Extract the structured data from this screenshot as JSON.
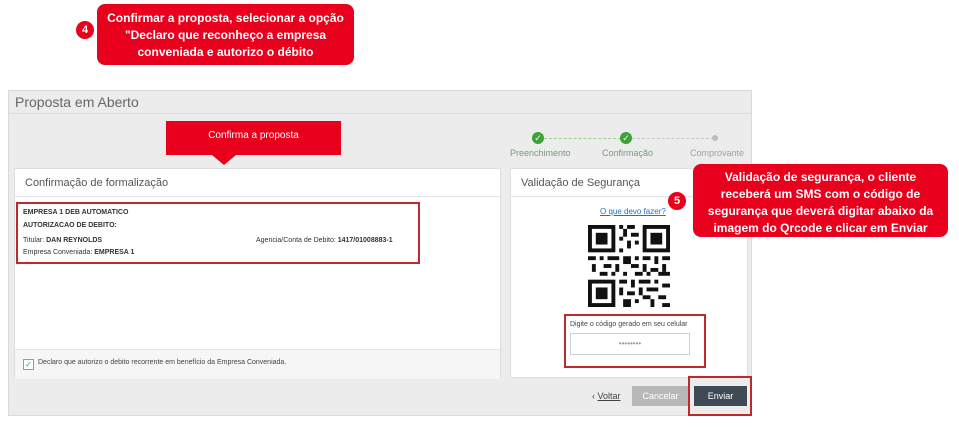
{
  "callouts": {
    "step4_number": "4",
    "step4_text": "Confirmar a proposta, selecionar a opção \"Declaro que reconheço a empresa conveniada e autorizo o débito",
    "step5_number": "5",
    "step5_text": "Validação de segurança, o cliente receberá um SMS com o código de segurança que deverá digitar abaixo da imagem do Qrcode e clicar em Enviar",
    "confirma_label": "Confirma a proposta"
  },
  "panel": {
    "title": "Proposta em Aberto"
  },
  "stepper": {
    "steps": [
      {
        "label": "Preenchimento",
        "state": "done"
      },
      {
        "label": "Confirmação",
        "state": "done"
      },
      {
        "label": "Comprovante",
        "state": "pending"
      }
    ],
    "check_glyph": "✓"
  },
  "formalizacao": {
    "header": "Confirmação de formalização",
    "line1": "EMPRESA 1 DEB AUTOMATICO",
    "line2": "AUTORIZACAO DE DEBITO:",
    "titular_label": "Titular:",
    "titular_value": "DAN REYNOLDS",
    "conta_label": "Agencia/Conta de Debito:",
    "conta_value": "1417/01008883-1",
    "empresa_label": "Empresa Conveniada:",
    "empresa_value": "EMPRESA 1",
    "checkbox_label": "Declaro que autorizo o debito recorrente em benefício da Empresa Conveniada."
  },
  "seguranca": {
    "header": "Validação de Segurança",
    "help_link": "O que devo fazer?",
    "code_label": "Digite o código gerado em seu celular",
    "code_placeholder": "••••••••"
  },
  "actions": {
    "voltar": "Voltar",
    "voltar_prefix": "‹",
    "cancelar": "Cancelar",
    "enviar": "Enviar"
  },
  "colors": {
    "accent_red": "#e8001c",
    "step_green": "#3da23a",
    "enviar_bg": "#3f4a55"
  }
}
